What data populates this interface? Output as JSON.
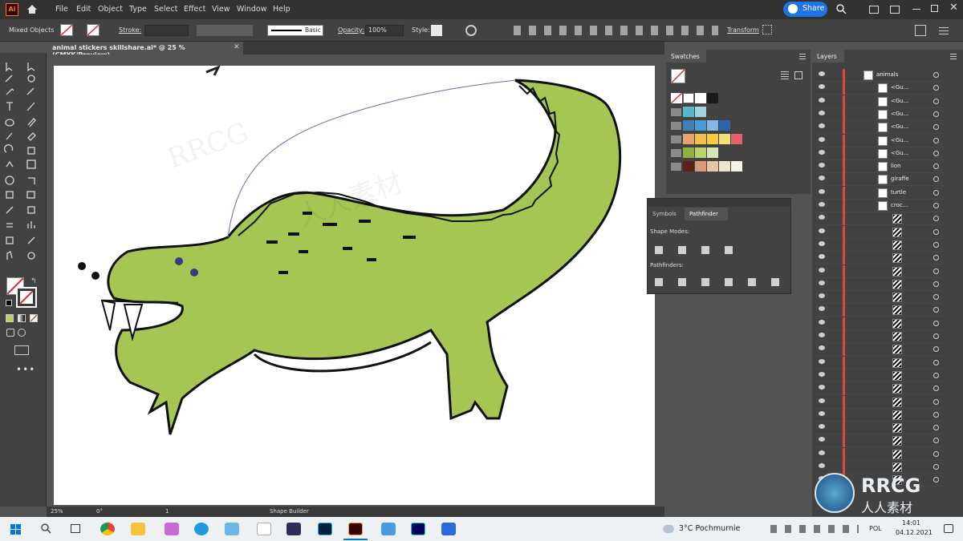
{
  "menu": [
    "File",
    "Edit",
    "Object",
    "Type",
    "Select",
    "Effect",
    "View",
    "Window",
    "Help"
  ],
  "share_label": "Share",
  "options": {
    "selection": "Mixed Objects",
    "stroke_label": "Stroke:",
    "brush": "Basic",
    "opacity_label": "Opacity:",
    "opacity_value": "100%",
    "style_label": "Style:",
    "transform_label": "Transform"
  },
  "document_tab": "animal stickers skillshare.ai* @ 25 % (CMYK/Preview)",
  "status": {
    "zoom": "25%",
    "rotation": "0°",
    "artboard_num": "1",
    "tool": "Shape Builder"
  },
  "swatches": {
    "title": "Swatches",
    "rows": [
      [
        "#ffffff",
        "#1a1a1a"
      ],
      [
        "#5ab7c7",
        "#9fd3de"
      ],
      [
        "#3f7fb8",
        "#4a9ad6",
        "#86b7e6",
        "#2e64a8"
      ],
      [
        "#e8a16a",
        "#f2c04a",
        "#f6cf38",
        "#f0e079",
        "#e8606b"
      ],
      [
        "#8fb339",
        "#b7d36d",
        "#d8e3b7"
      ],
      [
        "#5a2218",
        "#d49a7a",
        "#e6c6a8",
        "#ede4cf",
        "#f6f2e6"
      ]
    ]
  },
  "pathfinder": {
    "tab_symbols": "Symbols",
    "tab_pathfinder": "Pathfinder",
    "shape_modes": "Shape Modes:",
    "pathfinders": "Pathfinders:"
  },
  "layers": {
    "title": "Layers",
    "items": [
      "animals",
      "<Gu...",
      "<Gu...",
      "<Gu...",
      "<Gu...",
      "<Gu...",
      "<Gu...",
      "lion",
      "giraffe",
      "turtle",
      "croc..."
    ]
  },
  "taskbar": {
    "weather": "3°C  Pochmurnie",
    "lang": "POL",
    "time": "14:01",
    "date": "04.12.2021"
  },
  "watermark": "RRCG",
  "watermark_sub": "人人素材"
}
